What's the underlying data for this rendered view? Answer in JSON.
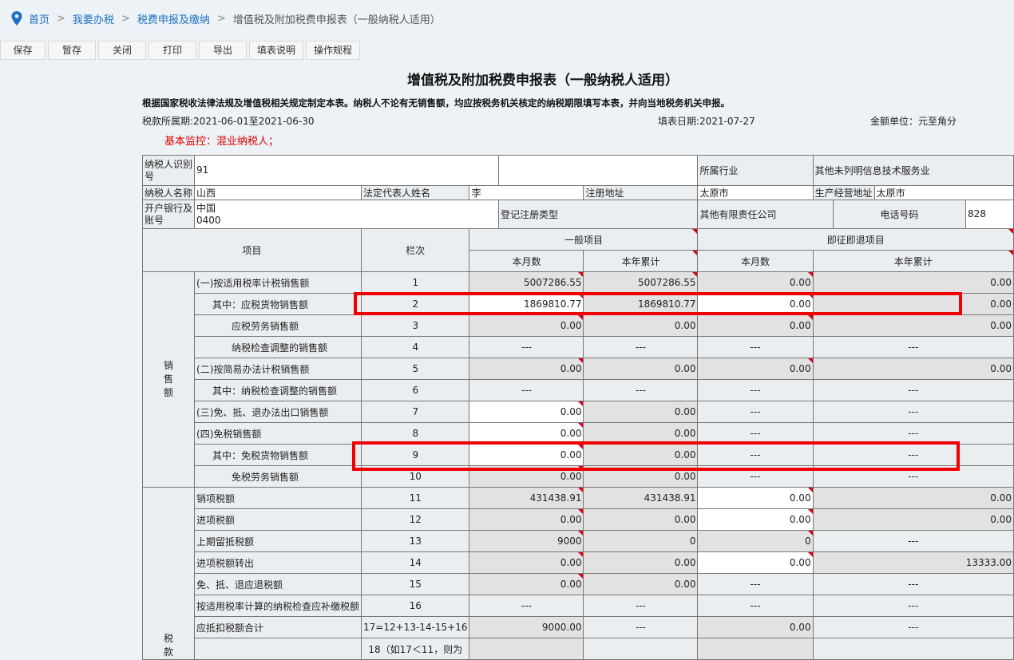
{
  "breadcrumb": {
    "home": "首页",
    "sep": ">",
    "level1": "我要办税",
    "level2": "税费申报及缴纳",
    "current": "增值税及附加税费申报表（一般纳税人适用）"
  },
  "toolbar": {
    "save": "保存",
    "draft": "暂存",
    "close": "关闭",
    "print": "打印",
    "export": "导出",
    "instructions": "填表说明",
    "procedure": "操作规程"
  },
  "form": {
    "title": "增值税及附加税费申报表（一般纳税人适用）",
    "note": "根据国家税收法律法规及增值税相关规定制定本表。纳税人不论有无销售额，均应按税务机关核定的纳税期限填写本表，并向当地税务机关申报。",
    "period": "税款所属期:2021-06-01至2021-06-30",
    "fill_date": "填表日期:2021-07-27",
    "unit": "金额单位：元至角分",
    "warning": "基本监控：混业纳税人；"
  },
  "taxpayer": {
    "id_label": "纳税人识别号",
    "id_value": "91",
    "industry_label": "所属行业",
    "industry_value": "其他未列明信息技术服务业",
    "name_label": "纳税人名称",
    "name_value": "山西",
    "legal_rep_label": "法定代表人姓名",
    "legal_rep_value": "李",
    "reg_addr_label": "注册地址",
    "reg_addr_value": "太原市",
    "biz_addr_label": "生产经营地址",
    "biz_addr_value": "太原市",
    "bank_label": "开户银行及账号",
    "bank_value_1": "中国",
    "bank_value_2": "0400",
    "reg_type_label": "登记注册类型",
    "reg_type_value": "其他有限责任公司",
    "phone_label": "电话号码",
    "phone_value": "828"
  },
  "headers": {
    "item": "项目",
    "column": "栏次",
    "general": "一般项目",
    "immediate": "即征即退项目",
    "month": "本月数",
    "year": "本年累计"
  },
  "sections": {
    "sales_1": "销",
    "sales_2": "售",
    "sales_3": "额",
    "tax_1": "税",
    "tax_2": "款"
  },
  "rows": [
    {
      "label": "(一)按适用税率计税销售额",
      "col": "1",
      "v1": "5007286.55",
      "v2": "5007286.55",
      "v3": "0.00",
      "v4": "0.00"
    },
    {
      "label": "其中：应税货物销售额",
      "col": "2",
      "v1": "1869810.77",
      "v2": "1869810.77",
      "v3": "0.00",
      "v4": "0.00"
    },
    {
      "label": "应税劳务销售额",
      "col": "3",
      "v1": "0.00",
      "v2": "0.00",
      "v3": "0.00",
      "v4": "0.00"
    },
    {
      "label": "纳税检查调整的销售额",
      "col": "4",
      "v1": "---",
      "v2": "---",
      "v3": "---",
      "v4": "---"
    },
    {
      "label": "(二)按简易办法计税销售额",
      "col": "5",
      "v1": "0.00",
      "v2": "0.00",
      "v3": "0.00",
      "v4": "0.00"
    },
    {
      "label": "其中：纳税检查调整的销售额",
      "col": "6",
      "v1": "---",
      "v2": "---",
      "v3": "---",
      "v4": "---"
    },
    {
      "label": "(三)免、抵、退办法出口销售额",
      "col": "7",
      "v1": "0.00",
      "v2": "0.00",
      "v3": "---",
      "v4": "---"
    },
    {
      "label": "(四)免税销售额",
      "col": "8",
      "v1": "0.00",
      "v2": "0.00",
      "v3": "---",
      "v4": "---"
    },
    {
      "label": "其中：免税货物销售额",
      "col": "9",
      "v1": "0.00",
      "v2": "0.00",
      "v3": "---",
      "v4": "---"
    },
    {
      "label": "免税劳务销售额",
      "col": "10",
      "v1": "0.00",
      "v2": "0.00",
      "v3": "---",
      "v4": "---"
    },
    {
      "label": "销项税额",
      "col": "11",
      "v1": "431438.91",
      "v2": "431438.91",
      "v3": "0.00",
      "v4": "0.00"
    },
    {
      "label": "进项税额",
      "col": "12",
      "v1": "0.00",
      "v2": "0.00",
      "v3": "0.00",
      "v4": "0.00"
    },
    {
      "label": "上期留抵税额",
      "col": "13",
      "v1": "9000",
      "v2": "0",
      "v3": "0",
      "v4": "---"
    },
    {
      "label": "进项税额转出",
      "col": "14",
      "v1": "0.00",
      "v2": "0.00",
      "v3": "0.00",
      "v4": "13333.00"
    },
    {
      "label": "免、抵、退应退税额",
      "col": "15",
      "v1": "0.00",
      "v2": "0.00",
      "v3": "---",
      "v4": "---"
    },
    {
      "label": "按适用税率计算的纳税检查应补缴税额",
      "col": "16",
      "v1": "---",
      "v2": "---",
      "v3": "---",
      "v4": "---"
    },
    {
      "label": "应抵扣税额合计",
      "col": "17=12+13-14-15+16",
      "v1": "9000.00",
      "v2": "---",
      "v3": "0.00",
      "v4": "---"
    },
    {
      "label": "",
      "col": "18（如17＜11，则为",
      "v1": "",
      "v2": "",
      "v3": "",
      "v4": ""
    }
  ]
}
